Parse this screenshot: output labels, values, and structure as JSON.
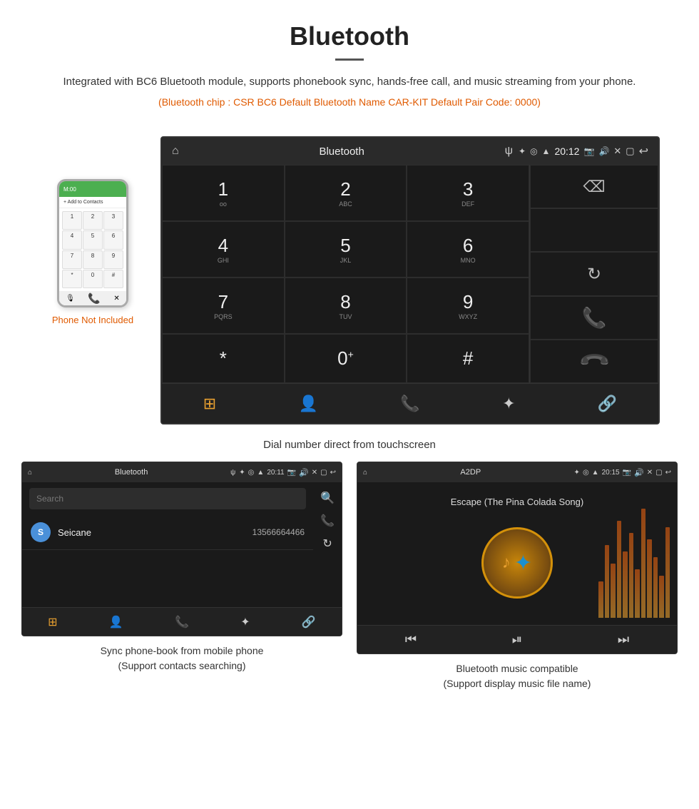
{
  "header": {
    "title": "Bluetooth",
    "description": "Integrated with BC6 Bluetooth module, supports phonebook sync, hands-free call, and music streaming from your phone.",
    "specs": "(Bluetooth chip : CSR BC6    Default Bluetooth Name CAR-KIT    Default Pair Code: 0000)"
  },
  "main_screen": {
    "status_bar": {
      "title": "Bluetooth",
      "usb_symbol": "ψ",
      "bt_symbol": "✦",
      "gps_symbol": "◎",
      "signal_symbol": "▲",
      "time": "20:12"
    },
    "dialpad": {
      "keys": [
        {
          "digit": "1",
          "sub": "oo"
        },
        {
          "digit": "2",
          "sub": "ABC"
        },
        {
          "digit": "3",
          "sub": "DEF"
        },
        {
          "digit": "4",
          "sub": "GHI"
        },
        {
          "digit": "5",
          "sub": "JKL"
        },
        {
          "digit": "6",
          "sub": "MNO"
        },
        {
          "digit": "7",
          "sub": "PQRS"
        },
        {
          "digit": "8",
          "sub": "TUV"
        },
        {
          "digit": "9",
          "sub": "WXYZ"
        },
        {
          "digit": "*",
          "sub": ""
        },
        {
          "digit": "0⁺",
          "sub": ""
        },
        {
          "digit": "#",
          "sub": ""
        }
      ]
    },
    "caption": "Dial number direct from touchscreen"
  },
  "phone_mockup": {
    "not_included_text": "Phone Not Included",
    "dial_keys": [
      "1",
      "2",
      "3",
      "4",
      "5",
      "6",
      "7",
      "8",
      "9",
      "*",
      "0",
      "#"
    ]
  },
  "contacts_screen": {
    "status_bar": {
      "title": "Bluetooth",
      "time": "20:11"
    },
    "search_placeholder": "Search",
    "contact": {
      "initial": "S",
      "name": "Seicane",
      "number": "13566664466"
    },
    "caption_line1": "Sync phone-book from mobile phone",
    "caption_line2": "(Support contacts searching)"
  },
  "music_screen": {
    "status_bar": {
      "title": "A2DP",
      "time": "20:15"
    },
    "song_title": "Escape (The Pina Colada Song)",
    "caption_line1": "Bluetooth music compatible",
    "caption_line2": "(Support display music file name)"
  },
  "bottom_nav": {
    "icons": [
      "grid",
      "person",
      "phone",
      "bluetooth",
      "link"
    ]
  },
  "watermark": "Seicane"
}
